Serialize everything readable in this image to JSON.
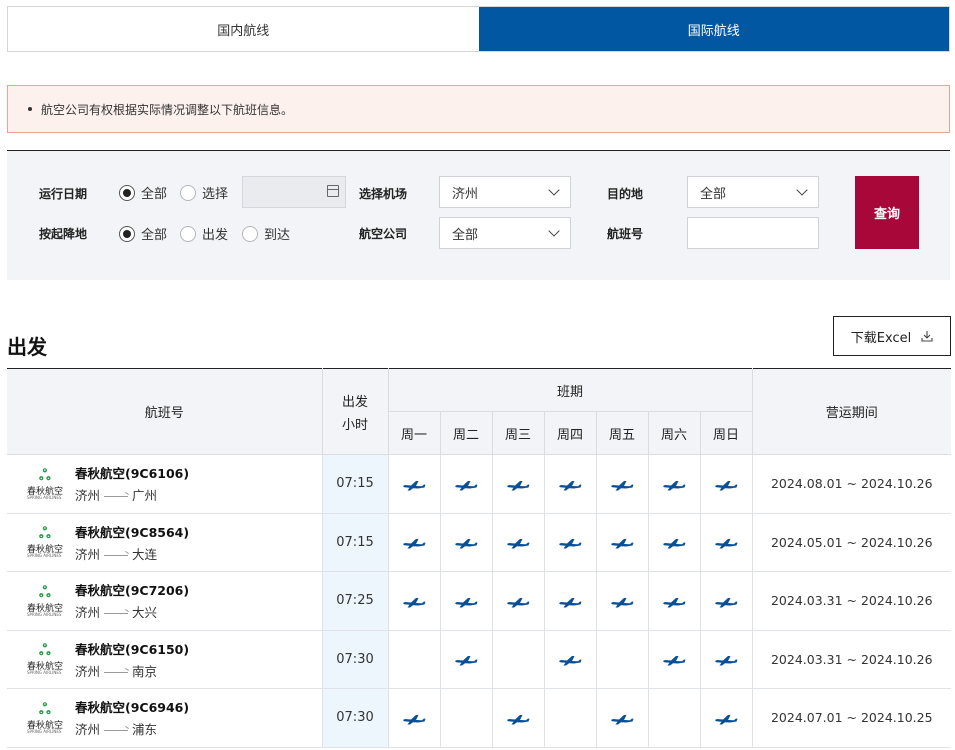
{
  "tabs": [
    {
      "label": "国内航线",
      "active": false
    },
    {
      "label": "国际航线",
      "active": true
    }
  ],
  "notice": "航空公司有权根据实际情况调整以下航班信息。",
  "filter": {
    "run_date_label": "运行日期",
    "run_date_options": [
      {
        "label": "全部",
        "selected": true
      },
      {
        "label": "选择",
        "selected": false
      }
    ],
    "date_value": "",
    "airport_label": "选择机场",
    "airport_value": "济州",
    "destination_label": "目的地",
    "destination_value": "全部",
    "direction_label": "按起降地",
    "direction_options": [
      {
        "label": "全部",
        "selected": true
      },
      {
        "label": "出发",
        "selected": false
      },
      {
        "label": "到达",
        "selected": false
      }
    ],
    "airline_label": "航空公司",
    "airline_value": "全部",
    "flight_no_label": "航班号",
    "flight_no_value": "",
    "search_label": "查询"
  },
  "section": {
    "title": "出发",
    "excel_label": "下载Excel"
  },
  "table": {
    "headers": {
      "flight": "航班号",
      "hour_line1": "出发",
      "hour_line2": "小时",
      "schedule": "班期",
      "period": "营运期间",
      "days": [
        "周一",
        "周二",
        "周三",
        "周四",
        "周五",
        "周六",
        "周日"
      ]
    },
    "logo": {
      "cn": "春秋航空",
      "en": "SPRING AIRLINES"
    },
    "rows": [
      {
        "name": "春秋航空(9C6106)",
        "from": "济州",
        "to": "广州",
        "hour": "07:15",
        "days": [
          true,
          true,
          true,
          true,
          true,
          true,
          true
        ],
        "period": "2024.08.01 ~ 2024.10.26"
      },
      {
        "name": "春秋航空(9C8564)",
        "from": "济州",
        "to": "大连",
        "hour": "07:15",
        "days": [
          true,
          true,
          true,
          true,
          true,
          true,
          true
        ],
        "period": "2024.05.01 ~ 2024.10.26"
      },
      {
        "name": "春秋航空(9C7206)",
        "from": "济州",
        "to": "大兴",
        "hour": "07:25",
        "days": [
          true,
          true,
          true,
          true,
          true,
          true,
          true
        ],
        "period": "2024.03.31 ~ 2024.10.26"
      },
      {
        "name": "春秋航空(9C6150)",
        "from": "济州",
        "to": "南京",
        "hour": "07:30",
        "days": [
          false,
          true,
          false,
          true,
          false,
          true,
          true
        ],
        "period": "2024.03.31 ~ 2024.10.26"
      },
      {
        "name": "春秋航空(9C6946)",
        "from": "济州",
        "to": "浦东",
        "hour": "07:30",
        "days": [
          true,
          false,
          true,
          false,
          true,
          false,
          true
        ],
        "period": "2024.07.01 ~ 2024.10.25"
      }
    ]
  },
  "colors": {
    "active_tab": "#0257a3",
    "search_button": "#a8073a",
    "plane_icon": "#0b4f97",
    "logo_green": "#1b9a3f",
    "notice_bg": "#fdf1ee"
  }
}
